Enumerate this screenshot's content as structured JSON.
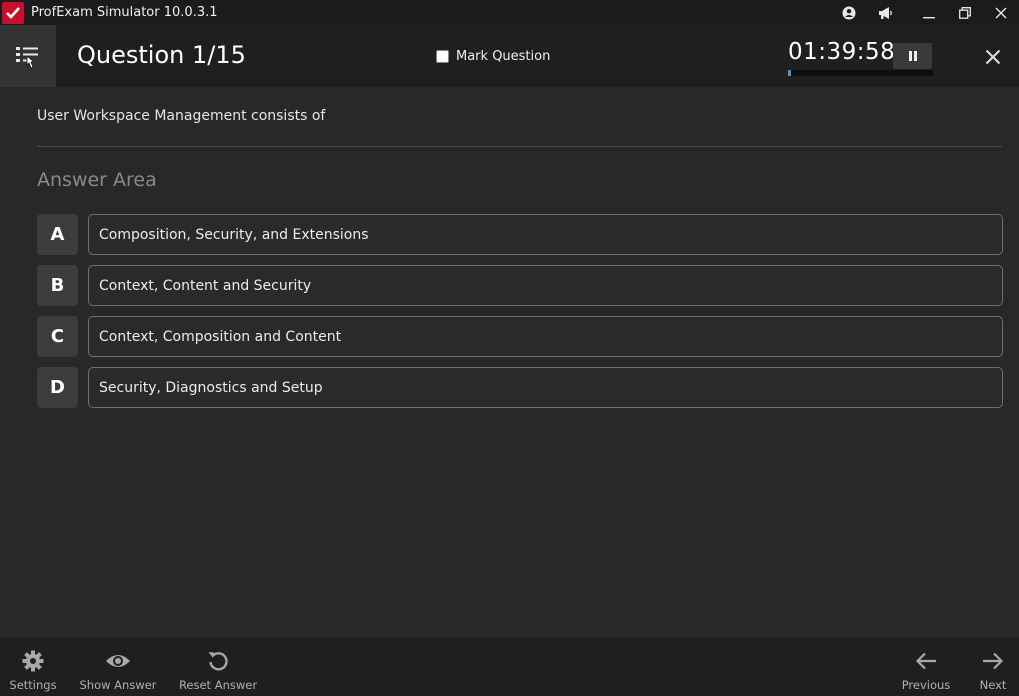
{
  "window": {
    "title": "ProfExam Simulator 10.0.3.1",
    "controls": [
      "user-icon",
      "megaphone-icon",
      "minimize-icon",
      "restore-icon",
      "close-icon"
    ]
  },
  "header": {
    "question_label": "Question 1/15",
    "mark_question_label": "Mark Question",
    "mark_question_checked": false,
    "timer": "01:39:58",
    "timer_progress": 0.02
  },
  "question": {
    "text": "User Workspace Management consists of"
  },
  "answer_area": {
    "title": "Answer Area",
    "options": [
      {
        "letter": "A",
        "text": "Composition, Security, and Extensions"
      },
      {
        "letter": "B",
        "text": "Context, Content and Security"
      },
      {
        "letter": "C",
        "text": "Context, Composition and Content"
      },
      {
        "letter": "D",
        "text": "Security, Diagnostics and Setup"
      }
    ]
  },
  "footer": {
    "settings_label": "Settings",
    "show_answer_label": "Show Answer",
    "reset_answer_label": "Reset Answer",
    "previous_label": "Previous",
    "next_label": "Next"
  },
  "colors": {
    "background": "#282828",
    "header": "#1f1f1f",
    "titlebar": "#1b1b1b",
    "logo": "#c8102e",
    "timer_fill": "#4a8fd8"
  }
}
